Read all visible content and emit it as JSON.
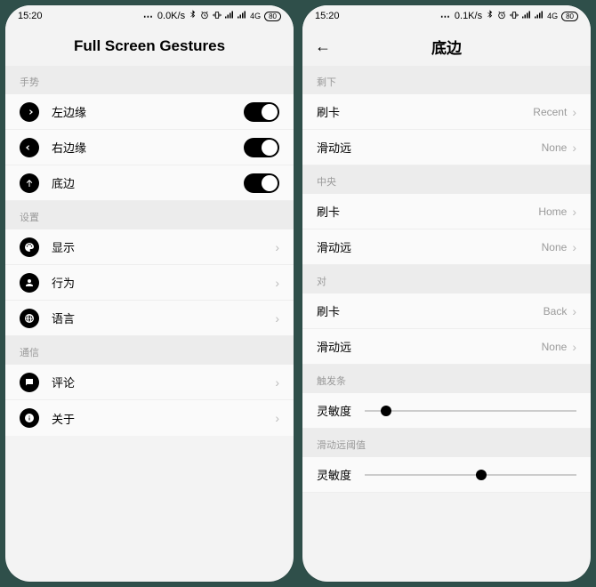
{
  "left": {
    "status": {
      "time": "15:20",
      "net": "0.0K/s",
      "signal": "4G",
      "battery": "80"
    },
    "title": "Full Screen Gestures",
    "sections": {
      "gestures": {
        "header": "手势",
        "items": [
          {
            "icon": "arrow-right",
            "label": "左边缘",
            "toggle": true
          },
          {
            "icon": "arrow-left",
            "label": "右边缘",
            "toggle": true
          },
          {
            "icon": "arrow-up",
            "label": "底边",
            "toggle": true
          }
        ]
      },
      "settings": {
        "header": "设置",
        "items": [
          {
            "icon": "palette",
            "label": "显示"
          },
          {
            "icon": "person",
            "label": "行为"
          },
          {
            "icon": "globe",
            "label": "语言"
          }
        ]
      },
      "comm": {
        "header": "通信",
        "items": [
          {
            "icon": "chat",
            "label": "评论"
          },
          {
            "icon": "info",
            "label": "关于"
          }
        ]
      }
    }
  },
  "right": {
    "status": {
      "time": "15:20",
      "net": "0.1K/s",
      "signal": "4G",
      "battery": "80"
    },
    "title": "底边",
    "sections": {
      "sx": {
        "header": "剩下",
        "items": [
          {
            "label": "刷卡",
            "value": "Recent"
          },
          {
            "label": "滑动远",
            "value": "None"
          }
        ]
      },
      "zy": {
        "header": "中央",
        "items": [
          {
            "label": "刷卡",
            "value": "Home"
          },
          {
            "label": "滑动远",
            "value": "None"
          }
        ]
      },
      "dui": {
        "header": "对",
        "items": [
          {
            "label": "刷卡",
            "value": "Back"
          },
          {
            "label": "滑动远",
            "value": "None"
          }
        ]
      },
      "cft": {
        "header": "触发条",
        "slider": {
          "label": "灵敏度",
          "position": 10
        }
      },
      "hdy": {
        "header": "滑动远阈值",
        "slider": {
          "label": "灵敏度",
          "position": 55
        }
      }
    }
  },
  "glyphs": {
    "bt": "✱",
    "alarm": "⏰",
    "vib": "📳"
  }
}
